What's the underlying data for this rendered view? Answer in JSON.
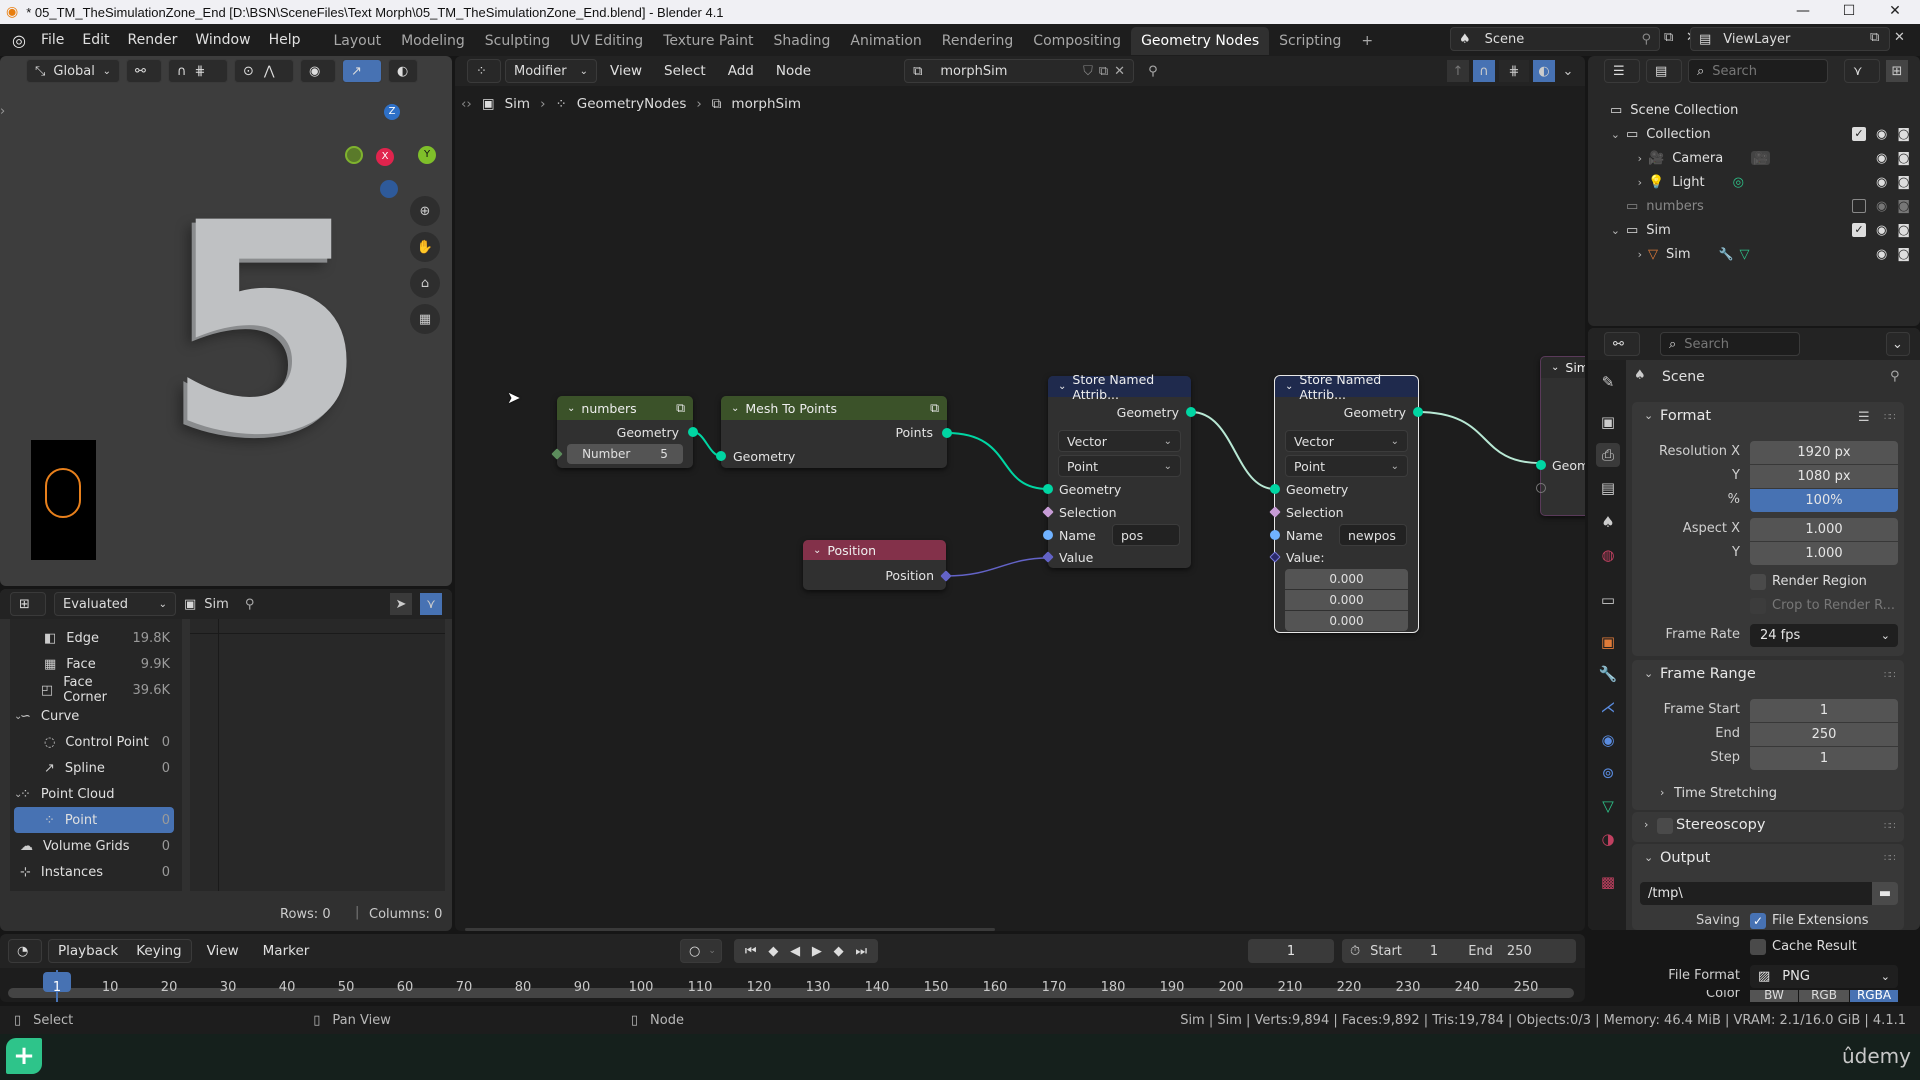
{
  "window": {
    "title": "* 05_TM_TheSimulationZone_End [D:\\BSN\\SceneFiles\\Text Morph\\05_TM_TheSimulationZone_End.blend] - Blender 4.1",
    "minimize": "—",
    "maximize": "☐",
    "close": "✕"
  },
  "menu": {
    "items": [
      "File",
      "Edit",
      "Render",
      "Window",
      "Help"
    ],
    "workspaces": [
      "Layout",
      "Modeling",
      "Sculpting",
      "UV Editing",
      "Texture Paint",
      "Shading",
      "Animation",
      "Rendering",
      "Compositing",
      "Geometry Nodes",
      "Scripting"
    ],
    "active_workspace": "Geometry Nodes",
    "add_workspace": "+",
    "scene": "Scene",
    "view_layer": "ViewLayer"
  },
  "viewport": {
    "orientation": "Global",
    "gizmo_axes": {
      "z": "Z",
      "x": "X",
      "y": "Y"
    },
    "object_text": "5"
  },
  "spreadsheet": {
    "mode": "Evaluated",
    "object": "Sim",
    "items": [
      {
        "label": "Edge",
        "count": "19.8K",
        "indent": 2
      },
      {
        "label": "Face",
        "count": "9.9K",
        "indent": 2
      },
      {
        "label": "Face Corner",
        "count": "39.6K",
        "indent": 2
      },
      {
        "label": "Curve",
        "count": "",
        "indent": 1
      },
      {
        "label": "Control Point",
        "count": "0",
        "indent": 2
      },
      {
        "label": "Spline",
        "count": "0",
        "indent": 2
      },
      {
        "label": "Point Cloud",
        "count": "",
        "indent": 1
      },
      {
        "label": "Point",
        "count": "0",
        "indent": 2,
        "selected": true
      },
      {
        "label": "Volume Grids",
        "count": "0",
        "indent": 1
      },
      {
        "label": "Instances",
        "count": "0",
        "indent": 1
      }
    ],
    "rows": "Rows: 0",
    "columns": "Columns: 0"
  },
  "node_editor": {
    "header": {
      "type": "Modifier",
      "menus": [
        "View",
        "Select",
        "Add",
        "Node"
      ],
      "node_group": "morphSim"
    },
    "breadcrumb": [
      "Sim",
      "GeometryNodes",
      "morphSim"
    ],
    "nodes": {
      "numbers": {
        "title": "numbers",
        "output": "Geometry",
        "input_label": "Number",
        "input_value": "5"
      },
      "mesh_to_points": {
        "title": "Mesh To Points",
        "output": "Points",
        "input": "Geometry"
      },
      "position": {
        "title": "Position",
        "output": "Position"
      },
      "store1": {
        "title": "Store Named Attrib...",
        "output": "Geometry",
        "data_type": "Vector",
        "domain": "Point",
        "inputs": [
          "Geometry",
          "Selection",
          "Name",
          "Value"
        ],
        "name_value": "pos"
      },
      "store2": {
        "title": "Store Named Attrib...",
        "output": "Geometry",
        "data_type": "Vector",
        "domain": "Point",
        "inputs": [
          "Geometry",
          "Selection",
          "Name",
          "Value:"
        ],
        "name_value": "newpos",
        "vector": [
          "0.000",
          "0.000",
          "0.000"
        ]
      },
      "partial": {
        "title": "Sim",
        "input": "Geom"
      }
    }
  },
  "outliner": {
    "search_placeholder": "Search",
    "items": [
      {
        "label": "Scene Collection",
        "level": 0
      },
      {
        "label": "Collection",
        "level": 1,
        "checked": true
      },
      {
        "label": "Camera",
        "level": 2
      },
      {
        "label": "Light",
        "level": 2
      },
      {
        "label": "numbers",
        "level": 1,
        "checked": false,
        "dimmed": true
      },
      {
        "label": "Sim",
        "level": 1,
        "checked": true
      },
      {
        "label": "Sim",
        "level": 2
      }
    ]
  },
  "properties": {
    "search_placeholder": "Search",
    "context": "Scene",
    "format": {
      "title": "Format",
      "resolution_x_label": "Resolution X",
      "resolution_x": "1920 px",
      "resolution_y_label": "Y",
      "resolution_y": "1080 px",
      "percent_label": "%",
      "percent": "100%",
      "aspect_x_label": "Aspect X",
      "aspect_x": "1.000",
      "aspect_y_label": "Y",
      "aspect_y": "1.000",
      "render_region": "Render Region",
      "crop": "Crop to Render R...",
      "frame_rate_label": "Frame Rate",
      "frame_rate": "24 fps"
    },
    "frame_range": {
      "title": "Frame Range",
      "start_label": "Frame Start",
      "start": "1",
      "end_label": "End",
      "end": "250",
      "step_label": "Step",
      "step": "1",
      "time_stretching": "Time Stretching"
    },
    "stereoscopy": "Stereoscopy",
    "output": {
      "title": "Output",
      "path": "/tmp\\",
      "saving_label": "Saving",
      "file_extensions": "File Extensions",
      "cache_result": "Cache Result",
      "file_format_label": "File Format",
      "file_format": "PNG",
      "color_label": "Color",
      "color_modes": [
        "BW",
        "RGB",
        "RGBA"
      ],
      "color_active": "RGBA"
    }
  },
  "timeline": {
    "menus": [
      "Playback",
      "Keying",
      "View",
      "Marker"
    ],
    "current_frame": "1",
    "start_label": "Start",
    "start": "1",
    "end_label": "End",
    "end": "250",
    "ticks": [
      "1",
      "10",
      "20",
      "30",
      "40",
      "50",
      "60",
      "70",
      "80",
      "90",
      "100",
      "110",
      "120",
      "130",
      "140",
      "150",
      "160",
      "170",
      "180",
      "190",
      "200",
      "210",
      "220",
      "230",
      "240",
      "250"
    ]
  },
  "statusbar": {
    "hints": [
      "Select",
      "Pan View",
      "Node"
    ],
    "stats": "Sim | Sim | Verts:9,894 | Faces:9,892 | Tris:19,784 | Objects:0/3 | Memory: 46.4 MiB | VRAM: 2.1/16.0 GiB | 4.1.1"
  },
  "overlay": {
    "watermark": "ûdemy"
  }
}
